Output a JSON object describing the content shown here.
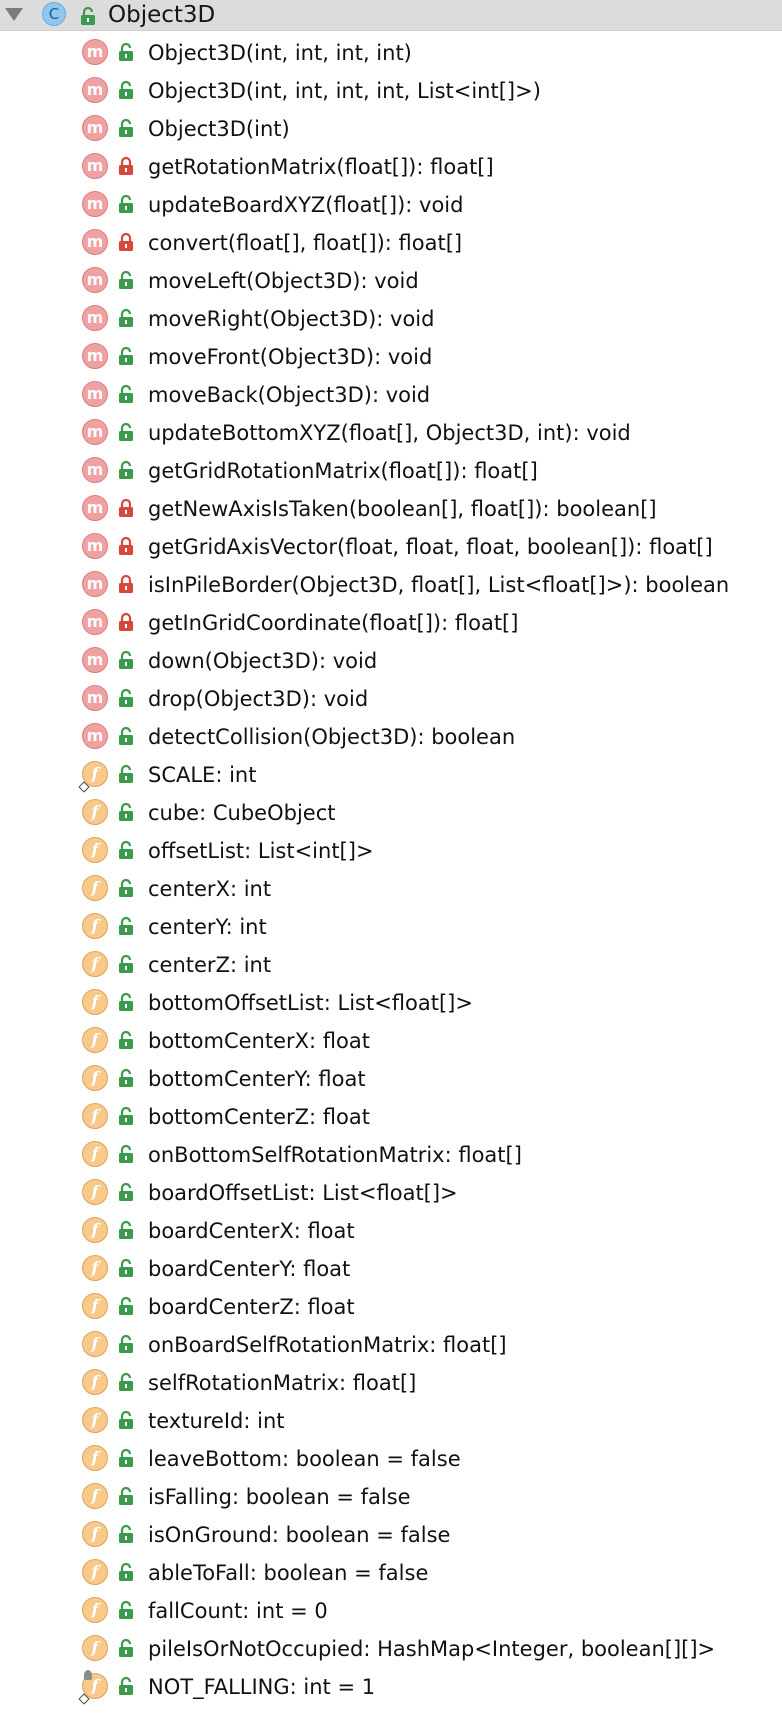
{
  "class_node": {
    "badge": "C",
    "title": "Object3D",
    "access": "public"
  },
  "colors": {
    "header_background": "#dcdcdc",
    "method_icon": "#f0a2a2",
    "field_icon": "#f7c98a",
    "public_lock": "#3b9b4c",
    "private_lock": "#d5493d",
    "class_icon": "#8fc7ef"
  },
  "members": [
    {
      "kind": "method",
      "kind_label": "m",
      "access": "public",
      "text": "Object3D(int, int, int, int)"
    },
    {
      "kind": "method",
      "kind_label": "m",
      "access": "public",
      "text": "Object3D(int, int, int, int, List<int[]>)"
    },
    {
      "kind": "method",
      "kind_label": "m",
      "access": "public",
      "text": "Object3D(int)"
    },
    {
      "kind": "method",
      "kind_label": "m",
      "access": "private",
      "text": "getRotationMatrix(float[]): float[]"
    },
    {
      "kind": "method",
      "kind_label": "m",
      "access": "public",
      "text": "updateBoardXYZ(float[]): void"
    },
    {
      "kind": "method",
      "kind_label": "m",
      "access": "private",
      "text": "convert(float[], float[]): float[]"
    },
    {
      "kind": "method",
      "kind_label": "m",
      "access": "public",
      "text": "moveLeft(Object3D): void"
    },
    {
      "kind": "method",
      "kind_label": "m",
      "access": "public",
      "text": "moveRight(Object3D): void"
    },
    {
      "kind": "method",
      "kind_label": "m",
      "access": "public",
      "text": "moveFront(Object3D): void"
    },
    {
      "kind": "method",
      "kind_label": "m",
      "access": "public",
      "text": "moveBack(Object3D): void"
    },
    {
      "kind": "method",
      "kind_label": "m",
      "access": "public",
      "text": "updateBottomXYZ(float[], Object3D, int): void"
    },
    {
      "kind": "method",
      "kind_label": "m",
      "access": "public",
      "text": "getGridRotationMatrix(float[]): float[]"
    },
    {
      "kind": "method",
      "kind_label": "m",
      "access": "private",
      "text": "getNewAxisIsTaken(boolean[], float[]): boolean[]"
    },
    {
      "kind": "method",
      "kind_label": "m",
      "access": "private",
      "text": "getGridAxisVector(float, float, float, boolean[]): float[]"
    },
    {
      "kind": "method",
      "kind_label": "m",
      "access": "private",
      "text": "isInPileBorder(Object3D, float[], List<float[]>): boolean"
    },
    {
      "kind": "method",
      "kind_label": "m",
      "access": "private",
      "text": "getInGridCoordinate(float[]): float[]"
    },
    {
      "kind": "method",
      "kind_label": "m",
      "access": "public",
      "text": "down(Object3D): void"
    },
    {
      "kind": "method",
      "kind_label": "m",
      "access": "public",
      "text": "drop(Object3D): void"
    },
    {
      "kind": "method",
      "kind_label": "m",
      "access": "public",
      "text": "detectCollision(Object3D): boolean"
    },
    {
      "kind": "field",
      "kind_label": "f",
      "access": "public",
      "static": true,
      "text": "SCALE: int"
    },
    {
      "kind": "field",
      "kind_label": "f",
      "access": "public",
      "text": "cube: CubeObject"
    },
    {
      "kind": "field",
      "kind_label": "f",
      "access": "public",
      "text": "offsetList: List<int[]>"
    },
    {
      "kind": "field",
      "kind_label": "f",
      "access": "public",
      "text": "centerX: int"
    },
    {
      "kind": "field",
      "kind_label": "f",
      "access": "public",
      "text": "centerY: int"
    },
    {
      "kind": "field",
      "kind_label": "f",
      "access": "public",
      "text": "centerZ: int"
    },
    {
      "kind": "field",
      "kind_label": "f",
      "access": "public",
      "text": "bottomOffsetList: List<float[]>"
    },
    {
      "kind": "field",
      "kind_label": "f",
      "access": "public",
      "text": "bottomCenterX: float"
    },
    {
      "kind": "field",
      "kind_label": "f",
      "access": "public",
      "text": "bottomCenterY: float"
    },
    {
      "kind": "field",
      "kind_label": "f",
      "access": "public",
      "text": "bottomCenterZ: float"
    },
    {
      "kind": "field",
      "kind_label": "f",
      "access": "public",
      "text": "onBottomSelfRotationMatrix: float[]"
    },
    {
      "kind": "field",
      "kind_label": "f",
      "access": "public",
      "text": "boardOffsetList: List<float[]>"
    },
    {
      "kind": "field",
      "kind_label": "f",
      "access": "public",
      "text": "boardCenterX: float"
    },
    {
      "kind": "field",
      "kind_label": "f",
      "access": "public",
      "text": "boardCenterY: float"
    },
    {
      "kind": "field",
      "kind_label": "f",
      "access": "public",
      "text": "boardCenterZ: float"
    },
    {
      "kind": "field",
      "kind_label": "f",
      "access": "public",
      "text": "onBoardSelfRotationMatrix: float[]"
    },
    {
      "kind": "field",
      "kind_label": "f",
      "access": "public",
      "text": "selfRotationMatrix: float[]"
    },
    {
      "kind": "field",
      "kind_label": "f",
      "access": "public",
      "text": "textureId: int"
    },
    {
      "kind": "field",
      "kind_label": "f",
      "access": "public",
      "text": "leaveBottom: boolean = false"
    },
    {
      "kind": "field",
      "kind_label": "f",
      "access": "public",
      "text": "isFalling: boolean = false"
    },
    {
      "kind": "field",
      "kind_label": "f",
      "access": "public",
      "text": "isOnGround: boolean = false"
    },
    {
      "kind": "field",
      "kind_label": "f",
      "access": "public",
      "text": "ableToFall: boolean = false"
    },
    {
      "kind": "field",
      "kind_label": "f",
      "access": "public",
      "text": "fallCount: int = 0"
    },
    {
      "kind": "field",
      "kind_label": "f",
      "access": "public",
      "text": "pileIsOrNotOccupied: HashMap<Integer, boolean[][]>"
    },
    {
      "kind": "field",
      "kind_label": "f",
      "access": "public",
      "static": true,
      "final": true,
      "text": "NOT_FALLING: int = 1"
    }
  ]
}
